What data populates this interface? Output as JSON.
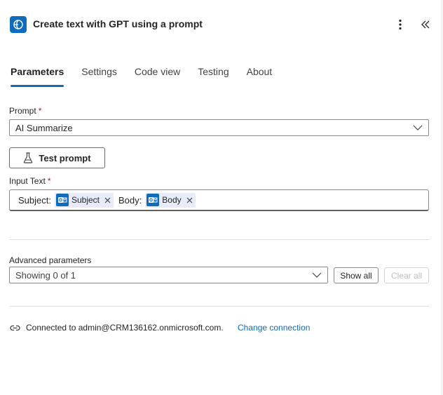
{
  "header": {
    "title": "Create text with GPT using a prompt",
    "icon": "ai-builder-icon",
    "more_icon": "more-vertical-icon",
    "collapse_icon": "double-chevron-left-icon"
  },
  "tabs": [
    {
      "label": "Parameters",
      "active": true
    },
    {
      "label": "Settings"
    },
    {
      "label": "Code view"
    },
    {
      "label": "Testing"
    },
    {
      "label": "About"
    }
  ],
  "prompt": {
    "label": "Prompt",
    "required_mark": "*",
    "value": "AI Summarize",
    "test_button": "Test prompt"
  },
  "input_text": {
    "label": "Input Text",
    "required_mark": "*",
    "parts": [
      {
        "text": "Subject:",
        "token": "Subject"
      },
      {
        "text": "Body:",
        "token": "Body"
      }
    ]
  },
  "advanced": {
    "label": "Advanced parameters",
    "value": "Showing 0 of 1",
    "show_all": "Show all",
    "clear_all": "Clear all"
  },
  "connection": {
    "text": "Connected to admin@CRM136162.onmicrosoft.com.",
    "change_link": "Change connection"
  },
  "colors": {
    "accent": "#0f6cbd",
    "required": "#c50f1f",
    "token_bg": "#e8ebfa"
  }
}
